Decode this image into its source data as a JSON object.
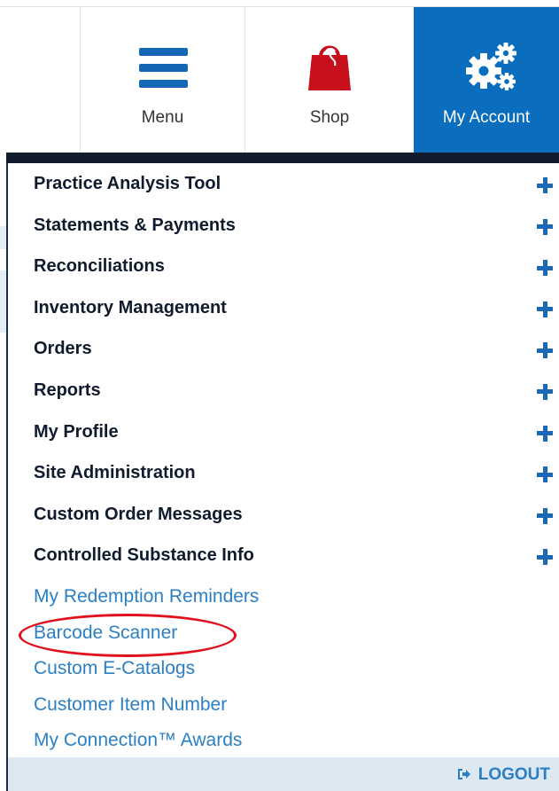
{
  "nav": {
    "tabs": [
      {
        "label": "Menu",
        "icon": "hamburger-menu-icon"
      },
      {
        "label": "Shop",
        "icon": "shopping-bag-icon"
      },
      {
        "label": "My Account",
        "icon": "gears-icon",
        "active": true
      }
    ]
  },
  "account_menu": {
    "expandable_items": [
      {
        "label": "Practice Analysis Tool"
      },
      {
        "label": "Statements & Payments"
      },
      {
        "label": "Reconciliations"
      },
      {
        "label": "Inventory Management"
      },
      {
        "label": "Orders"
      },
      {
        "label": "Reports"
      },
      {
        "label": "My Profile"
      },
      {
        "label": "Site Administration"
      },
      {
        "label": "Custom Order Messages"
      },
      {
        "label": "Controlled Substance Info"
      }
    ],
    "links": [
      {
        "label": "My Redemption Reminders"
      },
      {
        "label": "Barcode Scanner",
        "highlighted": true
      },
      {
        "label": "Custom E-Catalogs"
      },
      {
        "label": "Customer Item Number"
      },
      {
        "label": "My Connection™ Awards"
      }
    ],
    "logout_label": "LOGOUT"
  },
  "colors": {
    "accent": "#0b6dbe",
    "link": "#2b7fc5",
    "highlight": "#e0101c",
    "footer": "#dde8f2"
  }
}
